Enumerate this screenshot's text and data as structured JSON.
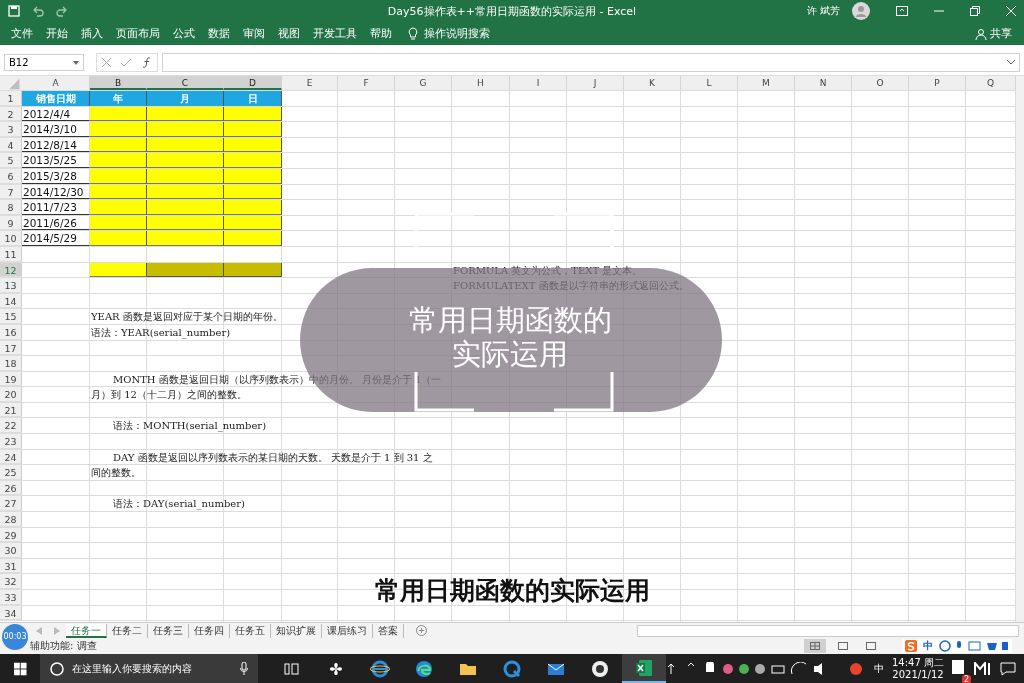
{
  "window": {
    "title": "Day56操作表++常用日期函数的实际运用 - Excel",
    "user": "许 斌芳"
  },
  "menu": [
    "文件",
    "开始",
    "插入",
    "页面布局",
    "公式",
    "数据",
    "审阅",
    "视图",
    "开发工具",
    "帮助"
  ],
  "tell_me": "操作说明搜索",
  "share": "共享",
  "formula_bar": {
    "name_box": "B12"
  },
  "columns": [
    {
      "label": "A",
      "selected": false
    },
    {
      "label": "B",
      "selected": true
    },
    {
      "label": "C",
      "selected": true
    },
    {
      "label": "D",
      "selected": true
    },
    {
      "label": "E",
      "selected": false
    },
    {
      "label": "F",
      "selected": false
    },
    {
      "label": "G",
      "selected": false
    },
    {
      "label": "H",
      "selected": false
    },
    {
      "label": "I",
      "selected": false
    },
    {
      "label": "J",
      "selected": false
    },
    {
      "label": "K",
      "selected": false
    },
    {
      "label": "L",
      "selected": false
    },
    {
      "label": "M",
      "selected": false
    },
    {
      "label": "N",
      "selected": false
    },
    {
      "label": "O",
      "selected": false
    },
    {
      "label": "P",
      "selected": false
    },
    {
      "label": "Q",
      "selected": false
    }
  ],
  "rows": [
    {
      "number": "1",
      "selected": false,
      "cells": [
        {
          "kind": "header",
          "text": "销售日期"
        },
        {
          "kind": "header",
          "text": "年"
        },
        {
          "kind": "header",
          "text": "月"
        },
        {
          "kind": "header",
          "text": "日"
        }
      ]
    },
    {
      "number": "2",
      "selected": false,
      "cells": [
        {
          "kind": "date",
          "text": "2012/4/4"
        },
        {
          "kind": "fill"
        },
        {
          "kind": "fill"
        },
        {
          "kind": "fill"
        }
      ]
    },
    {
      "number": "3",
      "selected": false,
      "cells": [
        {
          "kind": "date",
          "text": "2014/3/10"
        },
        {
          "kind": "fill"
        },
        {
          "kind": "fill"
        },
        {
          "kind": "fill"
        }
      ]
    },
    {
      "number": "4",
      "selected": false,
      "cells": [
        {
          "kind": "date",
          "text": "2012/8/14"
        },
        {
          "kind": "fill"
        },
        {
          "kind": "fill"
        },
        {
          "kind": "fill"
        }
      ]
    },
    {
      "number": "5",
      "selected": false,
      "cells": [
        {
          "kind": "date",
          "text": "2013/5/25"
        },
        {
          "kind": "fill"
        },
        {
          "kind": "fill"
        },
        {
          "kind": "fill"
        }
      ]
    },
    {
      "number": "6",
      "selected": false,
      "cells": [
        {
          "kind": "date",
          "text": "2015/3/28"
        },
        {
          "kind": "fill"
        },
        {
          "kind": "fill"
        },
        {
          "kind": "fill"
        }
      ]
    },
    {
      "number": "7",
      "selected": false,
      "cells": [
        {
          "kind": "date",
          "text": "2014/12/30"
        },
        {
          "kind": "fill"
        },
        {
          "kind": "fill"
        },
        {
          "kind": "fill"
        }
      ]
    },
    {
      "number": "8",
      "selected": false,
      "cells": [
        {
          "kind": "date",
          "text": "2011/7/23"
        },
        {
          "kind": "fill"
        },
        {
          "kind": "fill"
        },
        {
          "kind": "fill"
        }
      ]
    },
    {
      "number": "9",
      "selected": false,
      "cells": [
        {
          "kind": "date",
          "text": "2011/6/26"
        },
        {
          "kind": "fill"
        },
        {
          "kind": "fill"
        },
        {
          "kind": "fill"
        }
      ]
    },
    {
      "number": "10",
      "selected": false,
      "cells": [
        {
          "kind": "date",
          "text": "2014/5/29"
        },
        {
          "kind": "fill"
        },
        {
          "kind": "fill"
        },
        {
          "kind": "fill"
        }
      ]
    },
    {
      "number": "11",
      "selected": false,
      "cells": []
    },
    {
      "number": "12",
      "selected": true,
      "cells": [
        {
          "kind": "blank"
        },
        {
          "kind": "fill"
        },
        {
          "kind": "shaded"
        },
        {
          "kind": "shaded"
        },
        {
          "kind": "blank"
        },
        {
          "kind": "blank"
        },
        {
          "kind": "blank"
        },
        {
          "kind": "note",
          "text": "FORMULA 英文为公式，TEXT 是文本。"
        }
      ]
    },
    {
      "number": "13",
      "selected": false,
      "cells": [
        {
          "kind": "blank"
        },
        {
          "kind": "blank"
        },
        {
          "kind": "blank"
        },
        {
          "kind": "blank"
        },
        {
          "kind": "blank"
        },
        {
          "kind": "blank"
        },
        {
          "kind": "blank"
        },
        {
          "kind": "note",
          "text": "FORMULATEXT 函数是以字符串的形式返回公式。"
        }
      ]
    },
    {
      "number": "14",
      "selected": false,
      "cells": []
    },
    {
      "number": "15",
      "selected": false,
      "cells": [
        {
          "kind": "blank"
        },
        {
          "kind": "note",
          "text": "YEAR 函数是返回对应于某个日期的年份。"
        }
      ]
    },
    {
      "number": "16",
      "selected": false,
      "cells": [
        {
          "kind": "blank"
        },
        {
          "kind": "note",
          "text": "语法：YEAR(serial_number)"
        }
      ]
    },
    {
      "number": "17",
      "selected": false,
      "cells": []
    },
    {
      "number": "18",
      "selected": false,
      "cells": []
    },
    {
      "number": "19",
      "selected": false,
      "cells": [
        {
          "kind": "blank"
        },
        {
          "kind": "indent",
          "text": "MONTH  函数是返回日期（以序列数表示）中的月份。 月份是介于 1（一"
        }
      ]
    },
    {
      "number": "20",
      "selected": false,
      "cells": [
        {
          "kind": "blank"
        },
        {
          "kind": "note",
          "text": "月）到 12（十二月）之间的整数。"
        }
      ]
    },
    {
      "number": "21",
      "selected": false,
      "cells": []
    },
    {
      "number": "22",
      "selected": false,
      "cells": [
        {
          "kind": "blank"
        },
        {
          "kind": "indent",
          "text": "语法：MONTH(serial_number)"
        }
      ]
    },
    {
      "number": "23",
      "selected": false,
      "cells": []
    },
    {
      "number": "24",
      "selected": false,
      "cells": [
        {
          "kind": "blank"
        },
        {
          "kind": "indent",
          "text": "DAY  函数是返回以序列数表示的某日期的天数。 天数是介于 1 到 31 之"
        }
      ]
    },
    {
      "number": "25",
      "selected": false,
      "cells": [
        {
          "kind": "blank"
        },
        {
          "kind": "note",
          "text": "间的整数。"
        }
      ]
    },
    {
      "number": "26",
      "selected": false,
      "cells": []
    },
    {
      "number": "27",
      "selected": false,
      "cells": [
        {
          "kind": "blank"
        },
        {
          "kind": "indent",
          "text": "语法：DAY(serial_number)"
        }
      ]
    },
    {
      "number": "28",
      "selected": false,
      "cells": []
    },
    {
      "number": "29",
      "selected": false,
      "cells": []
    },
    {
      "number": "30",
      "selected": false,
      "cells": []
    },
    {
      "number": "31",
      "selected": false,
      "cells": []
    },
    {
      "number": "32",
      "selected": false,
      "cells": []
    },
    {
      "number": "33",
      "selected": false,
      "cells": []
    },
    {
      "number": "34",
      "selected": false,
      "cells": []
    }
  ],
  "title_overlay": {
    "line_1": "常用日期函数的",
    "line_2": "实际运用"
  },
  "subtitle": "常用日期函数的实际运用",
  "sheet_tabs": [
    {
      "label": "任务一",
      "selected": true
    },
    {
      "label": "任务二",
      "selected": false
    },
    {
      "label": "任务三",
      "selected": false
    },
    {
      "label": "任务四",
      "selected": false
    },
    {
      "label": "任务五",
      "selected": false
    },
    {
      "label": "知识扩展",
      "selected": false
    },
    {
      "label": "课后练习",
      "selected": false
    },
    {
      "label": "答案",
      "selected": false
    }
  ],
  "status_bar": {
    "timer": "00:03",
    "accessibility": "辅助功能: 调查",
    "views": [
      {
        "selected": true
      },
      {
        "selected": false
      },
      {
        "selected": false
      }
    ],
    "ime": "中"
  },
  "taskbar": {
    "search_placeholder": "在这里输入你要搜索的内容",
    "apps": [
      {
        "kind": "taskview",
        "selected": false
      },
      {
        "kind": "pinwheel",
        "selected": false
      },
      {
        "kind": "ie",
        "selected": false
      },
      {
        "kind": "edge",
        "selected": false
      },
      {
        "kind": "folder",
        "selected": false
      },
      {
        "kind": "q",
        "selected": false
      },
      {
        "kind": "mail",
        "selected": false
      },
      {
        "kind": "camera",
        "selected": false
      },
      {
        "kind": "excel",
        "selected": true
      }
    ],
    "ime": "中",
    "time": "14:47 周二",
    "date": "2021/1/12",
    "notifications": "2"
  }
}
